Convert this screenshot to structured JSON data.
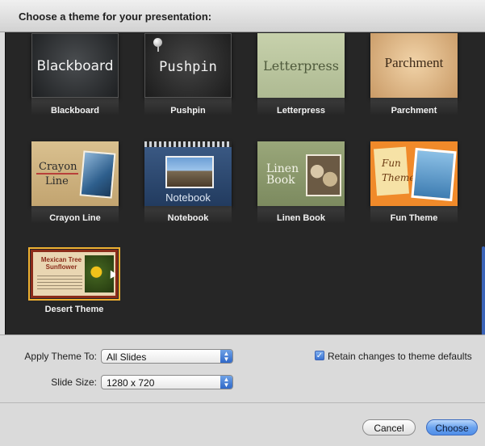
{
  "dialog": {
    "title": "Choose a theme for your presentation:"
  },
  "themes": [
    {
      "label": "Blackboard",
      "thumb_text": "Blackboard"
    },
    {
      "label": "Pushpin",
      "thumb_text": "Pushpin"
    },
    {
      "label": "Letterpress",
      "thumb_text": "Letterpress"
    },
    {
      "label": "Parchment",
      "thumb_text": "Parchment"
    },
    {
      "label": "Crayon Line",
      "thumb_title": "Crayon",
      "thumb_sub": "Line"
    },
    {
      "label": "Notebook",
      "thumb_text": "Notebook"
    },
    {
      "label": "Linen Book",
      "thumb_line1": "Linen",
      "thumb_line2": "Book"
    },
    {
      "label": "Fun Theme",
      "thumb_line1": "Fun",
      "thumb_line2": "Theme"
    },
    {
      "label": "Desert Theme",
      "thumb_line1": "Mexican Tree",
      "thumb_line2": "Sunflower"
    }
  ],
  "selected_theme": "Desert Theme",
  "options": {
    "apply_label": "Apply Theme To:",
    "apply_value": "All Slides",
    "size_label": "Slide Size:",
    "size_value": "1280 x 720",
    "retain_checked": true,
    "retain_label": "Retain changes to theme defaults"
  },
  "buttons": {
    "cancel": "Cancel",
    "choose": "Choose"
  },
  "colors": {
    "gallery_bg": "#262626",
    "selection": "#f0b030",
    "accent": "#3a72d2"
  }
}
